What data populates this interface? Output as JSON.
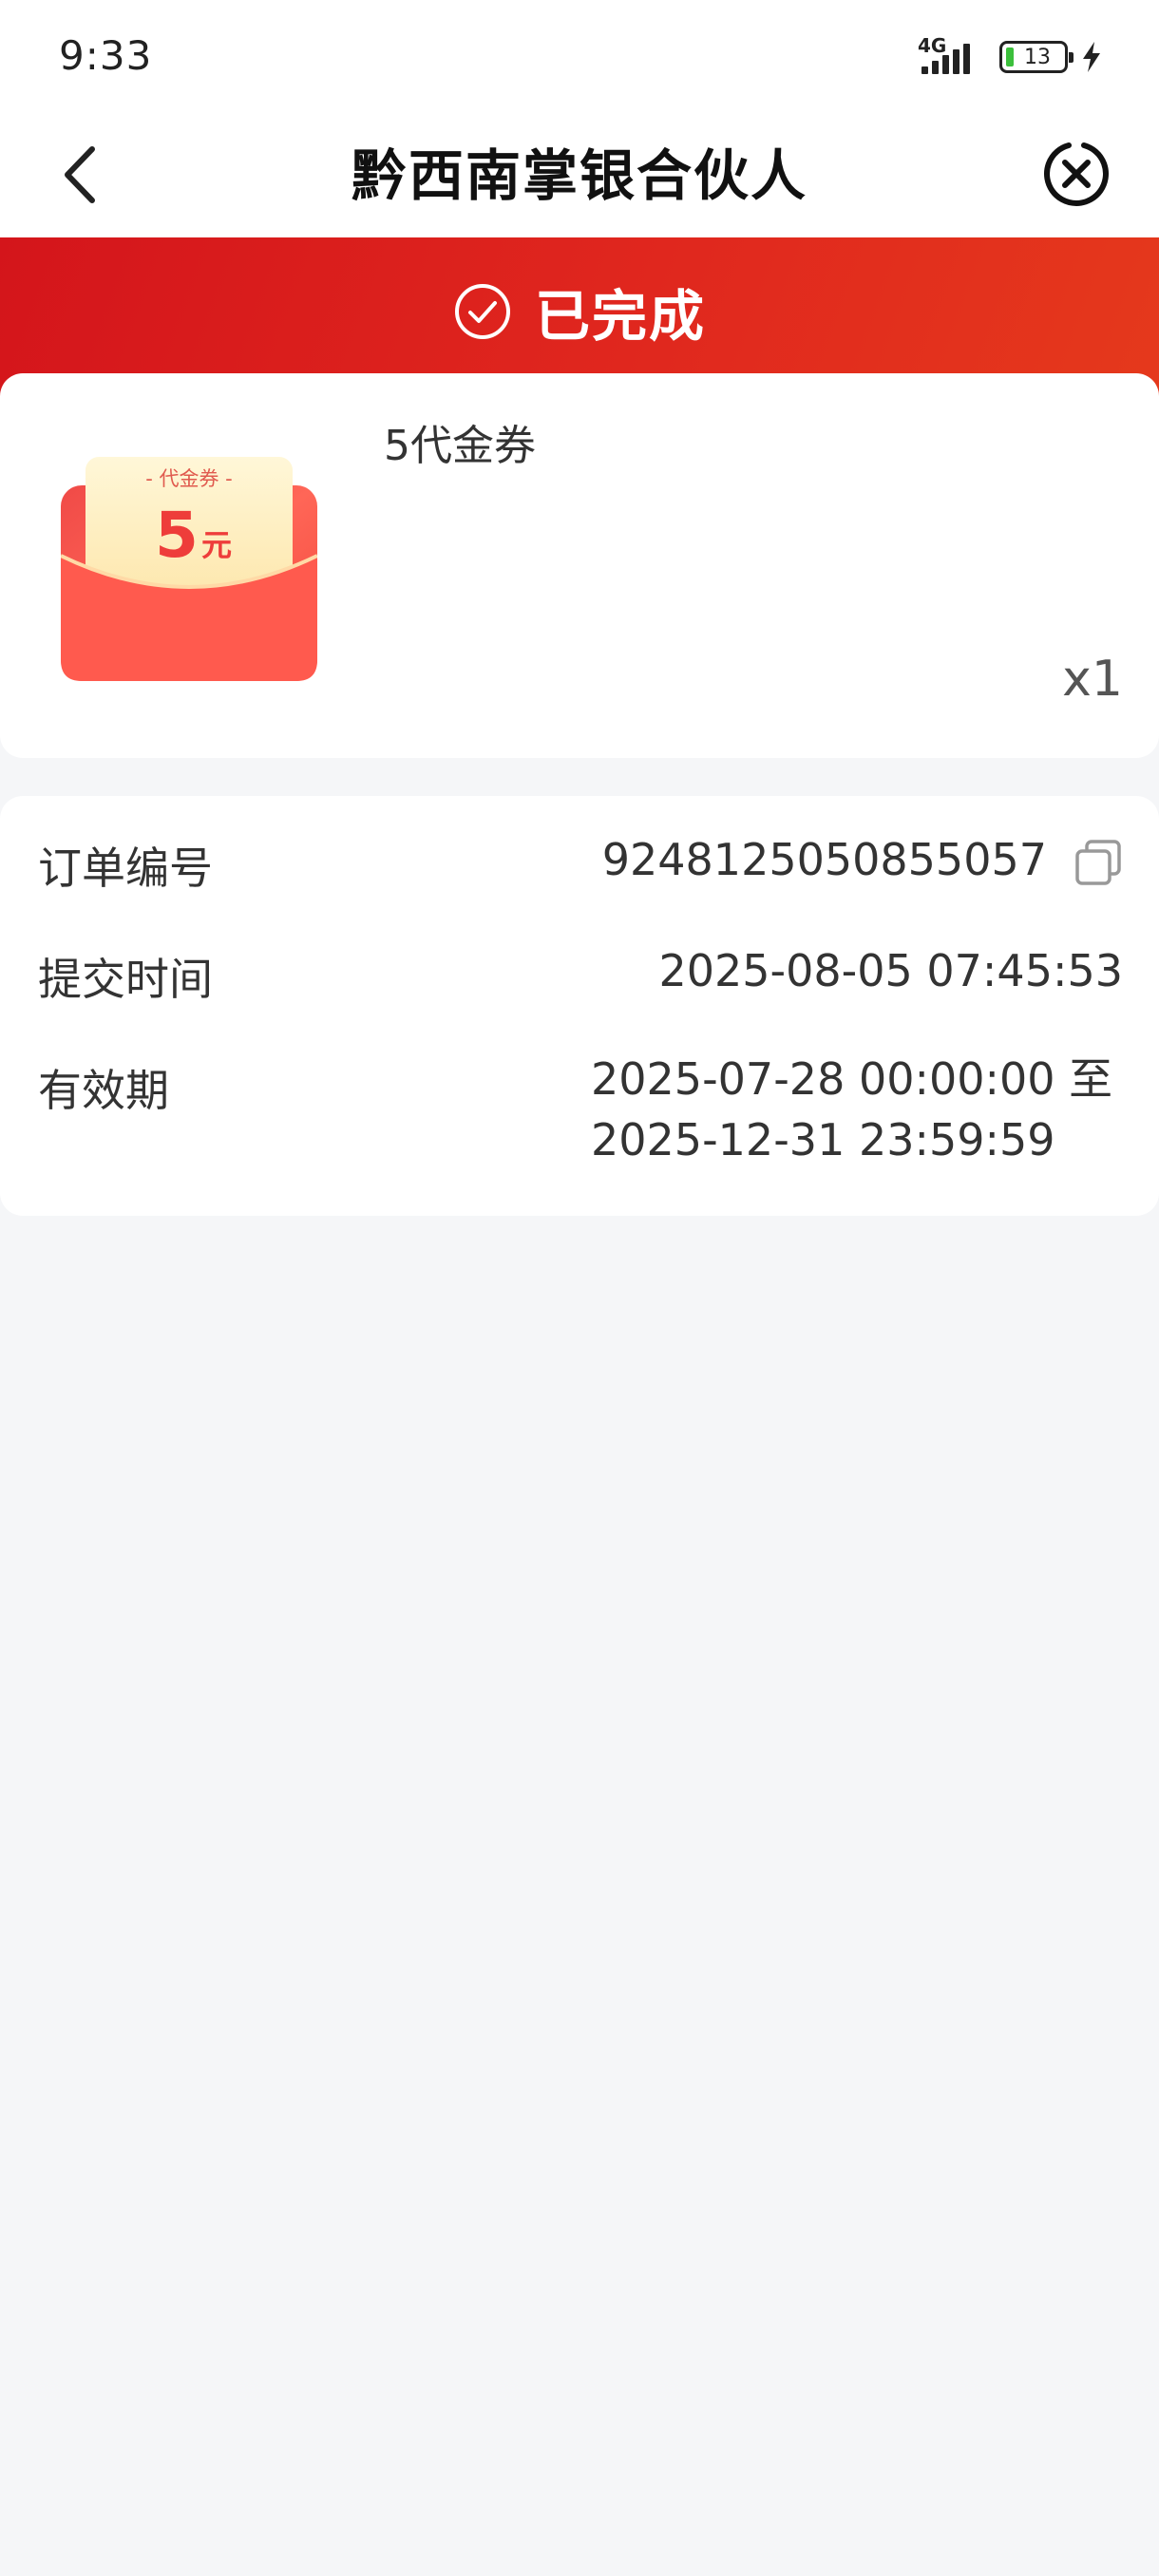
{
  "status_bar": {
    "time": "9:33",
    "network": "4G",
    "battery": "13",
    "icons": [
      "signal-icon",
      "battery-icon",
      "charging-bolt-icon"
    ]
  },
  "nav": {
    "title": "黔西南掌银合伙人",
    "back_icon": "chevron-left-icon",
    "close_icon": "close-circle-icon"
  },
  "order_status": {
    "text": "已完成",
    "icon": "check-circle-icon",
    "colors": {
      "banner_start": "#d4151b",
      "banner_end": "#e5391c"
    }
  },
  "product": {
    "name": "5代金券",
    "quantity": "x1",
    "coupon_image": {
      "label": "- 代金券 -",
      "amount": "5",
      "unit": "元"
    }
  },
  "details": {
    "order_number_label": "订单编号",
    "order_number": "9248125050855057",
    "submit_time_label": "提交时间",
    "submit_time": "2025-08-05 07:45:53",
    "validity_label": "有效期",
    "validity_line1": "2025-07-28 00:00:00 至",
    "validity_line2": "2025-12-31 23:59:59",
    "copy_icon": "copy-icon"
  }
}
